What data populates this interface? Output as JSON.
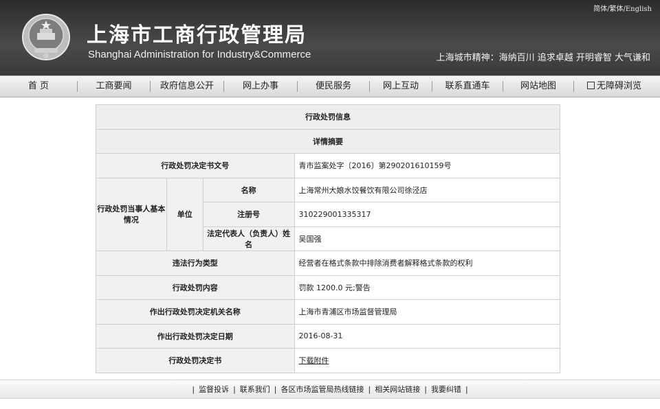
{
  "header": {
    "lang_links": [
      "简体",
      "繁体",
      "English"
    ],
    "title_cn": "上海市工商行政管理局",
    "title_en": "Shanghai Administration for Industry&Commerce",
    "slogan": "上海城市精神：海纳百川 追求卓越 开明睿智 大气谦和"
  },
  "nav": {
    "items": [
      "首 页",
      "工商要闻",
      "政府信息公开",
      "网上办事",
      "便民服务",
      "网上互动",
      "联系直通车",
      "网站地图",
      "无障碍浏览"
    ]
  },
  "table": {
    "title": "行政处罚信息",
    "subtitle": "详情摘要",
    "doc_no_label": "行政处罚决定书文号",
    "doc_no_value": "青市监案处字〔2016〕第290201610159号",
    "party_label": "行政处罚当事人基本情况",
    "unit_label": "单位",
    "name_label": "名称",
    "name_value": "上海常州大娘水饺餐饮有限公司徐泾店",
    "reg_label": "注册号",
    "reg_value": "310229001335317",
    "rep_label": "法定代表人（负责人）姓名",
    "rep_value": "吴国强",
    "violation_label": "违法行为类型",
    "violation_value": "经营者在格式条款中排除消费者解释格式条款的权利",
    "content_label": "行政处罚内容",
    "content_value": "罚款 1200.0 元;警告",
    "authority_label": "作出行政处罚决定机关名称",
    "authority_value": "上海市青浦区市场监督管理局",
    "date_label": "作出行政处罚决定日期",
    "date_value": "2016-08-31",
    "doc_label": "行政处罚决定书",
    "doc_value": "下载附件"
  },
  "footer": {
    "links": [
      "监督投诉",
      "联系我们",
      "各区市场监管局热线链接",
      "相关网站链接",
      "我要纠错"
    ]
  },
  "icons": {
    "emblem": "national-emblem-icon",
    "accessibility": "accessibility-icon"
  }
}
